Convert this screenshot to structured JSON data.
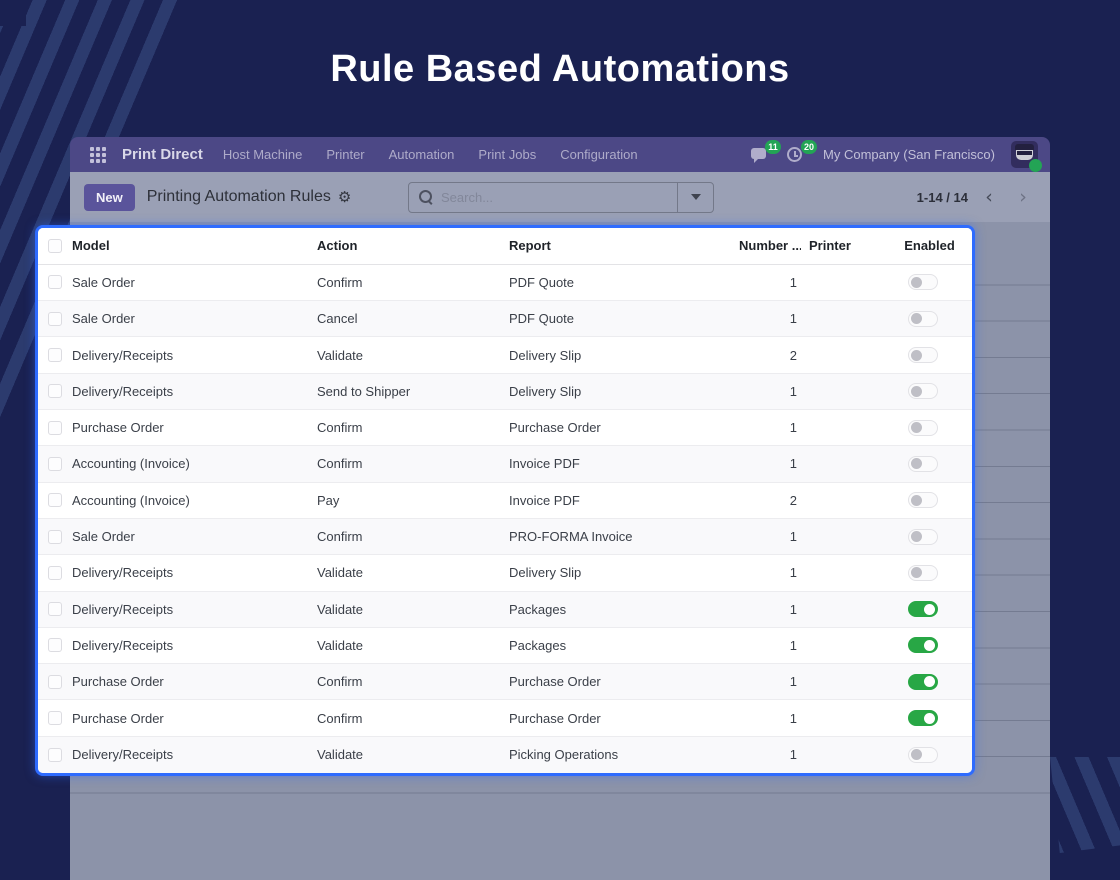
{
  "slide": {
    "title": "Rule Based Automations"
  },
  "app": {
    "brand": "Print Direct",
    "menu": [
      "Host Machine",
      "Printer",
      "Automation",
      "Print Jobs",
      "Configuration"
    ],
    "topbar": {
      "messages_badge": "11",
      "activities_badge": "20",
      "company": "My Company (San Francisco)"
    },
    "control_bar": {
      "new_button": "New",
      "view_title": "Printing Automation Rules",
      "gear_icon": "⚙",
      "search_placeholder": "Search...",
      "pager_text": "1-14 / 14",
      "prev_icon": "‹",
      "next_icon": "›"
    }
  },
  "table": {
    "headers": {
      "model": "Model",
      "action": "Action",
      "report": "Report",
      "number": "Number ...",
      "printer": "Printer",
      "enabled": "Enabled"
    },
    "rows": [
      {
        "model": "Sale Order",
        "action": "Confirm",
        "report": "PDF Quote",
        "number": "1",
        "printer": "",
        "enabled": false
      },
      {
        "model": "Sale Order",
        "action": "Cancel",
        "report": "PDF Quote",
        "number": "1",
        "printer": "",
        "enabled": false
      },
      {
        "model": "Delivery/Receipts",
        "action": "Validate",
        "report": "Delivery Slip",
        "number": "2",
        "printer": "",
        "enabled": false
      },
      {
        "model": "Delivery/Receipts",
        "action": "Send to Shipper",
        "report": "Delivery Slip",
        "number": "1",
        "printer": "",
        "enabled": false
      },
      {
        "model": "Purchase Order",
        "action": "Confirm",
        "report": "Purchase Order",
        "number": "1",
        "printer": "",
        "enabled": false
      },
      {
        "model": "Accounting (Invoice)",
        "action": "Confirm",
        "report": "Invoice PDF",
        "number": "1",
        "printer": "",
        "enabled": false
      },
      {
        "model": "Accounting (Invoice)",
        "action": "Pay",
        "report": "Invoice PDF",
        "number": "2",
        "printer": "",
        "enabled": false
      },
      {
        "model": "Sale Order",
        "action": "Confirm",
        "report": "PRO-FORMA Invoice",
        "number": "1",
        "printer": "",
        "enabled": false
      },
      {
        "model": "Delivery/Receipts",
        "action": "Validate",
        "report": "Delivery Slip",
        "number": "1",
        "printer": "",
        "enabled": false
      },
      {
        "model": "Delivery/Receipts",
        "action": "Validate",
        "report": "Packages",
        "number": "1",
        "printer": "",
        "enabled": true
      },
      {
        "model": "Delivery/Receipts",
        "action": "Validate",
        "report": "Packages",
        "number": "1",
        "printer": "",
        "enabled": true
      },
      {
        "model": "Purchase Order",
        "action": "Confirm",
        "report": "Purchase Order",
        "number": "1",
        "printer": "",
        "enabled": true
      },
      {
        "model": "Purchase Order",
        "action": "Confirm",
        "report": "Purchase Order",
        "number": "1",
        "printer": "",
        "enabled": true
      },
      {
        "model": "Delivery/Receipts",
        "action": "Validate",
        "report": "Picking Operations",
        "number": "1",
        "printer": "",
        "enabled": false
      }
    ]
  },
  "colors": {
    "page_background": "#1a2151",
    "stripe": "#2c3b6e",
    "navbar": "#4c4886",
    "control_bar": "#9aa0b5",
    "window_body": "#8c93a9",
    "highlight_border": "#2e6bfe",
    "toggle_on": "#28a745",
    "badge_green": "#23a455"
  }
}
